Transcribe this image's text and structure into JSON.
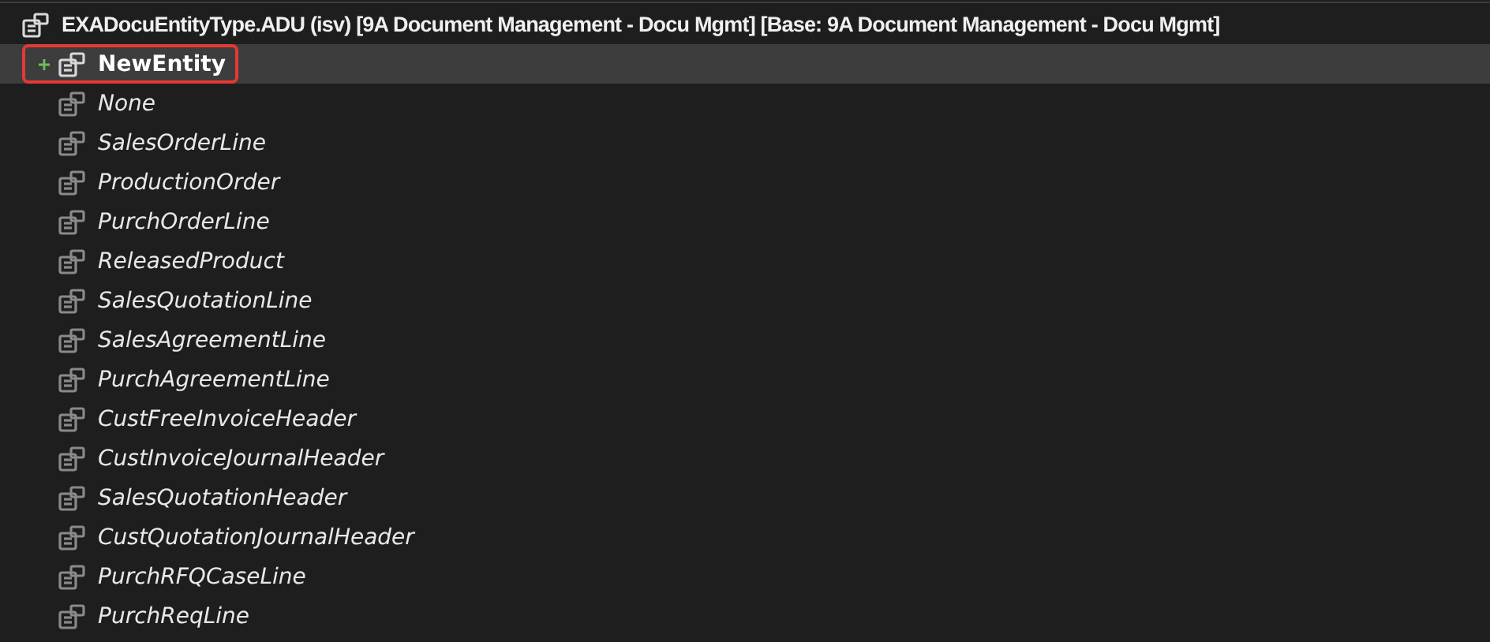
{
  "tree": {
    "label": "EXADocuEntityType.ADU (isv) [9A Document Management - Docu Mgmt] [Base: 9A Document Management - Docu Mgmt]",
    "children": [
      {
        "label": "NewEntity",
        "kind": "new",
        "selected": true,
        "highlighted": true
      },
      {
        "label": "None",
        "kind": "inherited",
        "selected": false,
        "highlighted": false
      },
      {
        "label": "SalesOrderLine",
        "kind": "inherited",
        "selected": false,
        "highlighted": false
      },
      {
        "label": "ProductionOrder",
        "kind": "inherited",
        "selected": false,
        "highlighted": false
      },
      {
        "label": "PurchOrderLine",
        "kind": "inherited",
        "selected": false,
        "highlighted": false
      },
      {
        "label": "ReleasedProduct",
        "kind": "inherited",
        "selected": false,
        "highlighted": false
      },
      {
        "label": "SalesQuotationLine",
        "kind": "inherited",
        "selected": false,
        "highlighted": false
      },
      {
        "label": "SalesAgreementLine",
        "kind": "inherited",
        "selected": false,
        "highlighted": false
      },
      {
        "label": "PurchAgreementLine",
        "kind": "inherited",
        "selected": false,
        "highlighted": false
      },
      {
        "label": "CustFreeInvoiceHeader",
        "kind": "inherited",
        "selected": false,
        "highlighted": false
      },
      {
        "label": "CustInvoiceJournalHeader",
        "kind": "inherited",
        "selected": false,
        "highlighted": false
      },
      {
        "label": "SalesQuotationHeader",
        "kind": "inherited",
        "selected": false,
        "highlighted": false
      },
      {
        "label": "CustQuotationJournalHeader",
        "kind": "inherited",
        "selected": false,
        "highlighted": false
      },
      {
        "label": "PurchRFQCaseLine",
        "kind": "inherited",
        "selected": false,
        "highlighted": false
      },
      {
        "label": "PurchReqLine",
        "kind": "inherited",
        "selected": false,
        "highlighted": false
      }
    ]
  }
}
